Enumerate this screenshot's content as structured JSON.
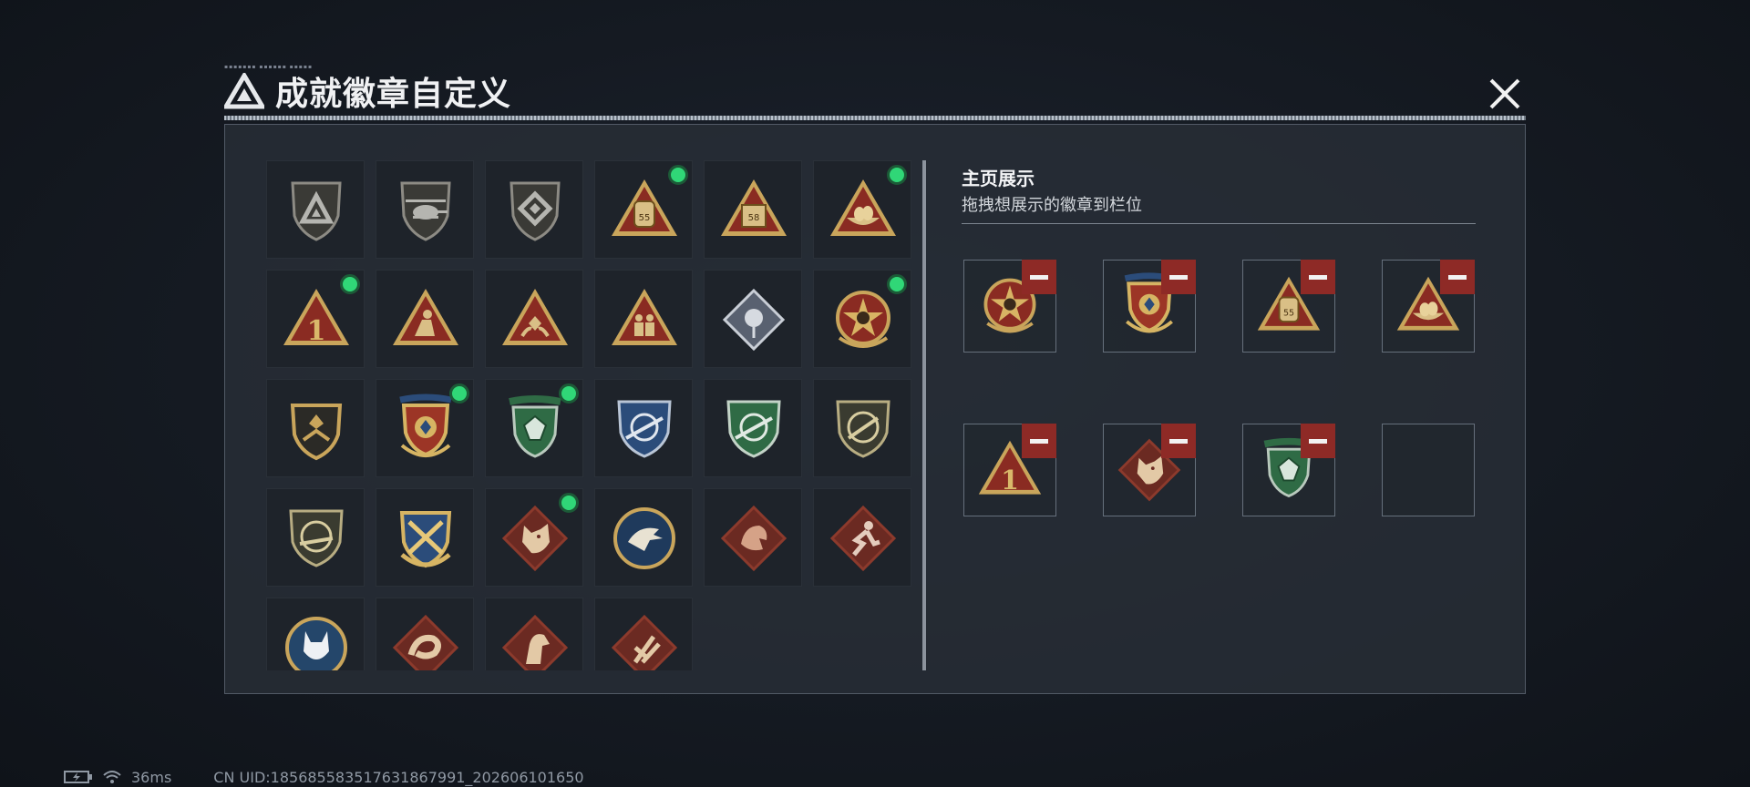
{
  "header": {
    "title": "成就徽章自定义",
    "logo_icon": "triangle-logo-icon",
    "small_text": "▪▪▪▪▪▪▪ ▪▪▪▪▪▪ ▪▪▪▪▪",
    "close_icon": "close-icon"
  },
  "badges": [
    {
      "icon": "gray-shield-triangle-icon",
      "new": false
    },
    {
      "icon": "gray-helicopter-icon",
      "new": false
    },
    {
      "icon": "gray-shield-diamond-icon",
      "new": false
    },
    {
      "icon": "backpack-55-triangle-icon",
      "new": true
    },
    {
      "icon": "box-58-triangle-icon",
      "new": false
    },
    {
      "icon": "nest-eggs-triangle-icon",
      "new": true
    },
    {
      "icon": "number-1-triangle-icon",
      "new": true
    },
    {
      "icon": "kneeling-figure-triangle-icon",
      "new": false
    },
    {
      "icon": "hands-diamond-triangle-icon",
      "new": false
    },
    {
      "icon": "soldiers-triangle-icon",
      "new": false
    },
    {
      "icon": "silver-rose-diamond-icon",
      "new": false
    },
    {
      "icon": "star-skull-wreath-icon",
      "new": true
    },
    {
      "icon": "gold-shield-chevron-icon",
      "new": false
    },
    {
      "icon": "blue-star-shield-eagle-icon",
      "new": true
    },
    {
      "icon": "green-gem-shield-icon",
      "new": true
    },
    {
      "icon": "blue-rifle-crosshair-icon",
      "new": false
    },
    {
      "icon": "green-rifle-crosshair-icon",
      "new": false
    },
    {
      "icon": "olive-rifle-shield-icon",
      "new": false
    },
    {
      "icon": "olive-rifle-crosshair-icon",
      "new": false
    },
    {
      "icon": "gold-crossed-rifles-icon",
      "new": false
    },
    {
      "icon": "wolf-diamond-icon",
      "new": true
    },
    {
      "icon": "eagle-circle-icon",
      "new": false
    },
    {
      "icon": "dragon-diamond-icon",
      "new": false
    },
    {
      "icon": "runner-diamond-icon",
      "new": false
    },
    {
      "icon": "snow-wolf-circle-icon",
      "new": false
    },
    {
      "icon": "snake-diamond-icon",
      "new": false
    },
    {
      "icon": "horse-diamond-icon",
      "new": false
    },
    {
      "icon": "hand-claw-diamond-icon",
      "new": false
    }
  ],
  "display": {
    "title": "主页展示",
    "subtitle": "拖拽想展示的徽章到栏位",
    "slots": [
      {
        "icon": "star-skull-wreath-icon",
        "filled": true
      },
      {
        "icon": "blue-star-shield-eagle-icon",
        "filled": true
      },
      {
        "icon": "backpack-55-triangle-icon",
        "filled": true
      },
      {
        "icon": "nest-eggs-triangle-icon",
        "filled": true
      },
      {
        "icon": "number-1-triangle-icon",
        "filled": true
      },
      {
        "icon": "wolf-diamond-icon",
        "filled": true
      },
      {
        "icon": "green-gem-shield-icon",
        "filled": true
      },
      {
        "icon": "",
        "filled": false
      }
    ],
    "remove_icon": "minus-icon"
  },
  "status_bar": {
    "battery_icon": "battery-charging-icon",
    "wifi_icon": "wifi-icon",
    "ping": "36ms",
    "uid": "CN UID:1856855835176318679​91_202606101650"
  },
  "colors": {
    "accent_gold": "#c9a55b",
    "new_dot": "#30d777",
    "remove_red": "#8e2a26",
    "badge_red": "#8a2b22",
    "badge_green": "#2f6b45",
    "badge_blue": "#2b4c7a"
  }
}
